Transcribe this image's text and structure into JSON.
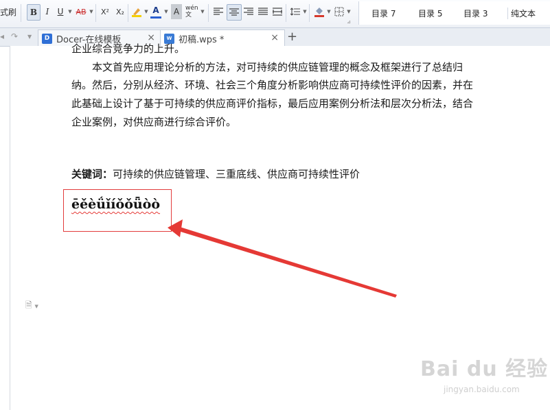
{
  "toolbar": {
    "format_painter_label": "式刷",
    "bold_label": "B",
    "italic_label": "I",
    "underline_label": "U",
    "strikethrough_label": "AB",
    "superscript_label": "X²",
    "subscript_label": "X₂",
    "font_color_label": "A",
    "char_shading_label": "A",
    "pinyin_label": "wén文"
  },
  "styles": [
    "目录 7",
    "目录 5",
    "目录 3",
    "纯文本"
  ],
  "tabs": [
    {
      "label": "Docer-在线模板",
      "icon": "docer-icon"
    },
    {
      "label": "初稿.wps *",
      "icon": "wps-doc-icon"
    }
  ],
  "document": {
    "line0": "企业综合竞争力的上升。",
    "line1": "本文首先应用理论分析的方法，对可持续的供应链管理的概念及框架进行了总结归",
    "line2": "纳。然后，分别从经济、环境、社会三个角度分析影响供应商可持续性评价的因素，并在",
    "line3": "此基础上设计了基于可持续的供应商评价指标，最后应用案例分析法和层次分析法，结合",
    "line4": "企业案例，对供应商进行综合评价。",
    "keywords_label": "关键词：",
    "keywords_value": "可持续的供应链管理、三重底线、供应商可持续性评价",
    "special_chars": "ēěèǘǐíǒǒǖòò"
  },
  "watermark": {
    "brand": "Bai du 经验",
    "url": "jingyan.baidu.com"
  },
  "colors": {
    "annotation_red": "#e53935",
    "ribbon_bg": "#eef1f6"
  }
}
